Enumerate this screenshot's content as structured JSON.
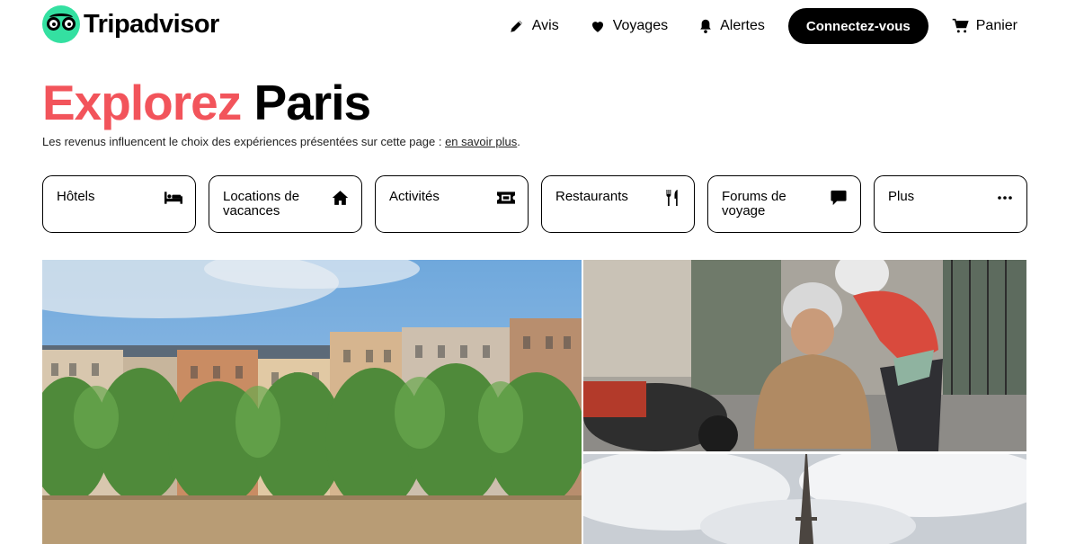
{
  "header": {
    "logo_text": "Tripadvisor",
    "nav": [
      {
        "label": "Avis",
        "icon": "pencil-icon"
      },
      {
        "label": "Voyages",
        "icon": "heart-icon"
      },
      {
        "label": "Alertes",
        "icon": "bell-icon"
      }
    ],
    "signin_label": "Connectez-vous",
    "cart_label": "Panier"
  },
  "hero": {
    "title_accent": "Explorez",
    "title_city": "Paris",
    "notice_text": "Les revenus influencent le choix des expériences présentées sur cette page : ",
    "notice_link": "en savoir plus",
    "notice_end": "."
  },
  "categories": [
    {
      "label": "Hôtels",
      "icon": "bed-icon"
    },
    {
      "label": "Locations de vacances",
      "icon": "home-icon"
    },
    {
      "label": "Activités",
      "icon": "ticket-icon"
    },
    {
      "label": "Restaurants",
      "icon": "utensils-icon"
    },
    {
      "label": "Forums de voyage",
      "icon": "chat-bubble-icon"
    },
    {
      "label": "Plus",
      "icon": "more-dots-icon"
    }
  ],
  "colors": {
    "accent": "#f2545b",
    "brand_green": "#34e0a1",
    "button_bg": "#000000"
  }
}
